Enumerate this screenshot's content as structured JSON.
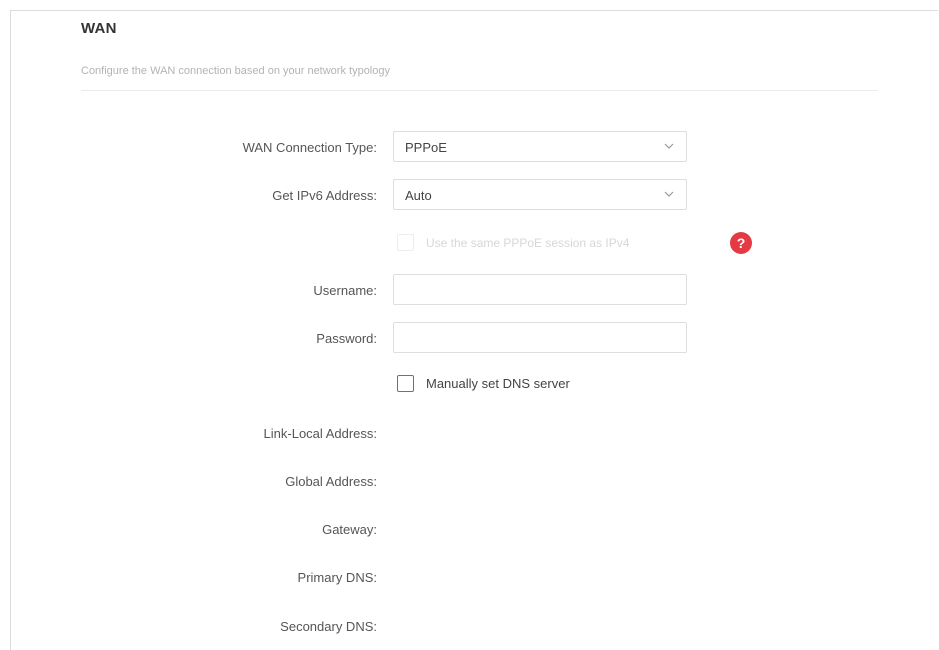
{
  "section": {
    "title": "WAN",
    "subtitle": "Configure the WAN connection based on your network typology"
  },
  "form": {
    "wan_connection_type": {
      "label": "WAN Connection Type:",
      "value": "PPPoE"
    },
    "get_ipv6_address": {
      "label": "Get IPv6 Address:",
      "value": "Auto"
    },
    "same_pppoe_session": {
      "label": "Use the same PPPoE session as IPv4",
      "checked": false,
      "disabled": true
    },
    "username": {
      "label": "Username:",
      "value": ""
    },
    "password": {
      "label": "Password:",
      "value": ""
    },
    "manual_dns": {
      "label": "Manually set DNS server",
      "checked": false
    },
    "link_local_address": {
      "label": "Link-Local Address:"
    },
    "global_address": {
      "label": "Global Address:"
    },
    "gateway": {
      "label": "Gateway:"
    },
    "primary_dns": {
      "label": "Primary DNS:"
    },
    "secondary_dns": {
      "label": "Secondary DNS:"
    }
  },
  "icons": {
    "help": "question-mark-icon",
    "dropdown": "chevron-down-icon"
  },
  "colors": {
    "accent": "#e33a44",
    "checkbox_border": "#c9485b"
  }
}
